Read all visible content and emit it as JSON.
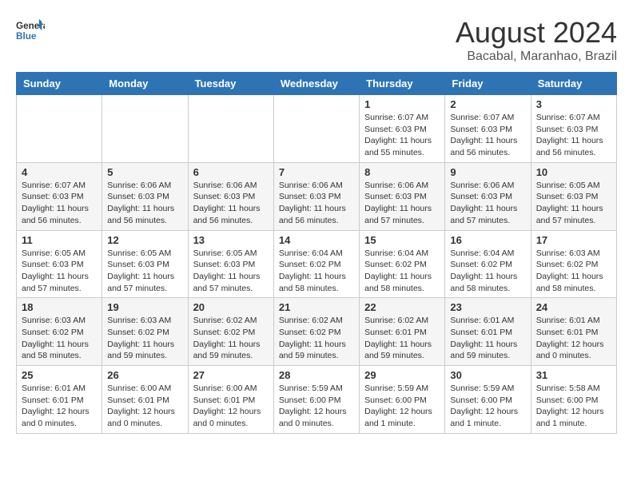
{
  "header": {
    "logo_general": "General",
    "logo_blue": "Blue",
    "month_year": "August 2024",
    "location": "Bacabal, Maranhao, Brazil"
  },
  "days_of_week": [
    "Sunday",
    "Monday",
    "Tuesday",
    "Wednesday",
    "Thursday",
    "Friday",
    "Saturday"
  ],
  "weeks": [
    [
      {
        "day": "",
        "info": ""
      },
      {
        "day": "",
        "info": ""
      },
      {
        "day": "",
        "info": ""
      },
      {
        "day": "",
        "info": ""
      },
      {
        "day": "1",
        "info": "Sunrise: 6:07 AM\nSunset: 6:03 PM\nDaylight: 11 hours\nand 55 minutes."
      },
      {
        "day": "2",
        "info": "Sunrise: 6:07 AM\nSunset: 6:03 PM\nDaylight: 11 hours\nand 56 minutes."
      },
      {
        "day": "3",
        "info": "Sunrise: 6:07 AM\nSunset: 6:03 PM\nDaylight: 11 hours\nand 56 minutes."
      }
    ],
    [
      {
        "day": "4",
        "info": "Sunrise: 6:07 AM\nSunset: 6:03 PM\nDaylight: 11 hours\nand 56 minutes."
      },
      {
        "day": "5",
        "info": "Sunrise: 6:06 AM\nSunset: 6:03 PM\nDaylight: 11 hours\nand 56 minutes."
      },
      {
        "day": "6",
        "info": "Sunrise: 6:06 AM\nSunset: 6:03 PM\nDaylight: 11 hours\nand 56 minutes."
      },
      {
        "day": "7",
        "info": "Sunrise: 6:06 AM\nSunset: 6:03 PM\nDaylight: 11 hours\nand 56 minutes."
      },
      {
        "day": "8",
        "info": "Sunrise: 6:06 AM\nSunset: 6:03 PM\nDaylight: 11 hours\nand 57 minutes."
      },
      {
        "day": "9",
        "info": "Sunrise: 6:06 AM\nSunset: 6:03 PM\nDaylight: 11 hours\nand 57 minutes."
      },
      {
        "day": "10",
        "info": "Sunrise: 6:05 AM\nSunset: 6:03 PM\nDaylight: 11 hours\nand 57 minutes."
      }
    ],
    [
      {
        "day": "11",
        "info": "Sunrise: 6:05 AM\nSunset: 6:03 PM\nDaylight: 11 hours\nand 57 minutes."
      },
      {
        "day": "12",
        "info": "Sunrise: 6:05 AM\nSunset: 6:03 PM\nDaylight: 11 hours\nand 57 minutes."
      },
      {
        "day": "13",
        "info": "Sunrise: 6:05 AM\nSunset: 6:03 PM\nDaylight: 11 hours\nand 57 minutes."
      },
      {
        "day": "14",
        "info": "Sunrise: 6:04 AM\nSunset: 6:02 PM\nDaylight: 11 hours\nand 58 minutes."
      },
      {
        "day": "15",
        "info": "Sunrise: 6:04 AM\nSunset: 6:02 PM\nDaylight: 11 hours\nand 58 minutes."
      },
      {
        "day": "16",
        "info": "Sunrise: 6:04 AM\nSunset: 6:02 PM\nDaylight: 11 hours\nand 58 minutes."
      },
      {
        "day": "17",
        "info": "Sunrise: 6:03 AM\nSunset: 6:02 PM\nDaylight: 11 hours\nand 58 minutes."
      }
    ],
    [
      {
        "day": "18",
        "info": "Sunrise: 6:03 AM\nSunset: 6:02 PM\nDaylight: 11 hours\nand 58 minutes."
      },
      {
        "day": "19",
        "info": "Sunrise: 6:03 AM\nSunset: 6:02 PM\nDaylight: 11 hours\nand 59 minutes."
      },
      {
        "day": "20",
        "info": "Sunrise: 6:02 AM\nSunset: 6:02 PM\nDaylight: 11 hours\nand 59 minutes."
      },
      {
        "day": "21",
        "info": "Sunrise: 6:02 AM\nSunset: 6:02 PM\nDaylight: 11 hours\nand 59 minutes."
      },
      {
        "day": "22",
        "info": "Sunrise: 6:02 AM\nSunset: 6:01 PM\nDaylight: 11 hours\nand 59 minutes."
      },
      {
        "day": "23",
        "info": "Sunrise: 6:01 AM\nSunset: 6:01 PM\nDaylight: 11 hours\nand 59 minutes."
      },
      {
        "day": "24",
        "info": "Sunrise: 6:01 AM\nSunset: 6:01 PM\nDaylight: 12 hours\nand 0 minutes."
      }
    ],
    [
      {
        "day": "25",
        "info": "Sunrise: 6:01 AM\nSunset: 6:01 PM\nDaylight: 12 hours\nand 0 minutes."
      },
      {
        "day": "26",
        "info": "Sunrise: 6:00 AM\nSunset: 6:01 PM\nDaylight: 12 hours\nand 0 minutes."
      },
      {
        "day": "27",
        "info": "Sunrise: 6:00 AM\nSunset: 6:01 PM\nDaylight: 12 hours\nand 0 minutes."
      },
      {
        "day": "28",
        "info": "Sunrise: 5:59 AM\nSunset: 6:00 PM\nDaylight: 12 hours\nand 0 minutes."
      },
      {
        "day": "29",
        "info": "Sunrise: 5:59 AM\nSunset: 6:00 PM\nDaylight: 12 hours\nand 1 minute."
      },
      {
        "day": "30",
        "info": "Sunrise: 5:59 AM\nSunset: 6:00 PM\nDaylight: 12 hours\nand 1 minute."
      },
      {
        "day": "31",
        "info": "Sunrise: 5:58 AM\nSunset: 6:00 PM\nDaylight: 12 hours\nand 1 minute."
      }
    ]
  ]
}
